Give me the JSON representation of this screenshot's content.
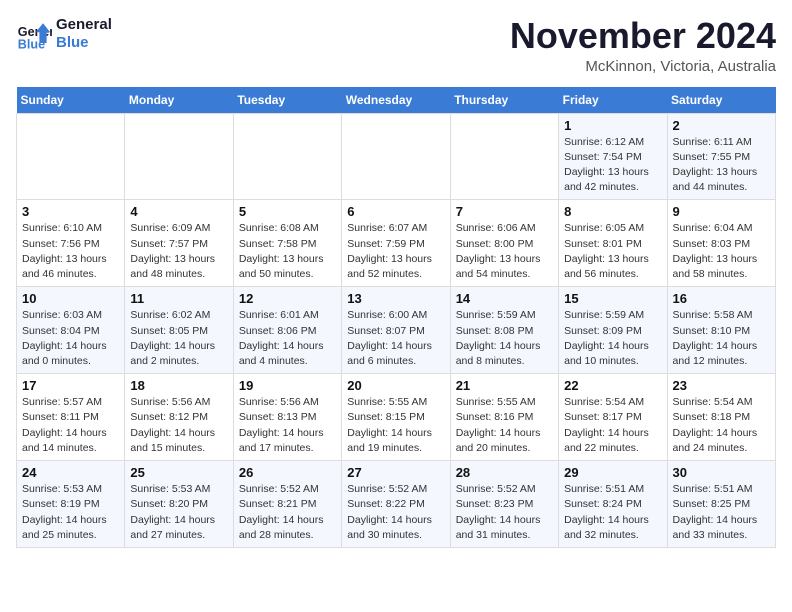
{
  "logo": {
    "line1": "General",
    "line2": "Blue"
  },
  "header": {
    "month": "November 2024",
    "location": "McKinnon, Victoria, Australia"
  },
  "weekdays": [
    "Sunday",
    "Monday",
    "Tuesday",
    "Wednesday",
    "Thursday",
    "Friday",
    "Saturday"
  ],
  "weeks": [
    [
      {
        "day": "",
        "info": ""
      },
      {
        "day": "",
        "info": ""
      },
      {
        "day": "",
        "info": ""
      },
      {
        "day": "",
        "info": ""
      },
      {
        "day": "",
        "info": ""
      },
      {
        "day": "1",
        "info": "Sunrise: 6:12 AM\nSunset: 7:54 PM\nDaylight: 13 hours and 42 minutes."
      },
      {
        "day": "2",
        "info": "Sunrise: 6:11 AM\nSunset: 7:55 PM\nDaylight: 13 hours and 44 minutes."
      }
    ],
    [
      {
        "day": "3",
        "info": "Sunrise: 6:10 AM\nSunset: 7:56 PM\nDaylight: 13 hours and 46 minutes."
      },
      {
        "day": "4",
        "info": "Sunrise: 6:09 AM\nSunset: 7:57 PM\nDaylight: 13 hours and 48 minutes."
      },
      {
        "day": "5",
        "info": "Sunrise: 6:08 AM\nSunset: 7:58 PM\nDaylight: 13 hours and 50 minutes."
      },
      {
        "day": "6",
        "info": "Sunrise: 6:07 AM\nSunset: 7:59 PM\nDaylight: 13 hours and 52 minutes."
      },
      {
        "day": "7",
        "info": "Sunrise: 6:06 AM\nSunset: 8:00 PM\nDaylight: 13 hours and 54 minutes."
      },
      {
        "day": "8",
        "info": "Sunrise: 6:05 AM\nSunset: 8:01 PM\nDaylight: 13 hours and 56 minutes."
      },
      {
        "day": "9",
        "info": "Sunrise: 6:04 AM\nSunset: 8:03 PM\nDaylight: 13 hours and 58 minutes."
      }
    ],
    [
      {
        "day": "10",
        "info": "Sunrise: 6:03 AM\nSunset: 8:04 PM\nDaylight: 14 hours and 0 minutes."
      },
      {
        "day": "11",
        "info": "Sunrise: 6:02 AM\nSunset: 8:05 PM\nDaylight: 14 hours and 2 minutes."
      },
      {
        "day": "12",
        "info": "Sunrise: 6:01 AM\nSunset: 8:06 PM\nDaylight: 14 hours and 4 minutes."
      },
      {
        "day": "13",
        "info": "Sunrise: 6:00 AM\nSunset: 8:07 PM\nDaylight: 14 hours and 6 minutes."
      },
      {
        "day": "14",
        "info": "Sunrise: 5:59 AM\nSunset: 8:08 PM\nDaylight: 14 hours and 8 minutes."
      },
      {
        "day": "15",
        "info": "Sunrise: 5:59 AM\nSunset: 8:09 PM\nDaylight: 14 hours and 10 minutes."
      },
      {
        "day": "16",
        "info": "Sunrise: 5:58 AM\nSunset: 8:10 PM\nDaylight: 14 hours and 12 minutes."
      }
    ],
    [
      {
        "day": "17",
        "info": "Sunrise: 5:57 AM\nSunset: 8:11 PM\nDaylight: 14 hours and 14 minutes."
      },
      {
        "day": "18",
        "info": "Sunrise: 5:56 AM\nSunset: 8:12 PM\nDaylight: 14 hours and 15 minutes."
      },
      {
        "day": "19",
        "info": "Sunrise: 5:56 AM\nSunset: 8:13 PM\nDaylight: 14 hours and 17 minutes."
      },
      {
        "day": "20",
        "info": "Sunrise: 5:55 AM\nSunset: 8:15 PM\nDaylight: 14 hours and 19 minutes."
      },
      {
        "day": "21",
        "info": "Sunrise: 5:55 AM\nSunset: 8:16 PM\nDaylight: 14 hours and 20 minutes."
      },
      {
        "day": "22",
        "info": "Sunrise: 5:54 AM\nSunset: 8:17 PM\nDaylight: 14 hours and 22 minutes."
      },
      {
        "day": "23",
        "info": "Sunrise: 5:54 AM\nSunset: 8:18 PM\nDaylight: 14 hours and 24 minutes."
      }
    ],
    [
      {
        "day": "24",
        "info": "Sunrise: 5:53 AM\nSunset: 8:19 PM\nDaylight: 14 hours and 25 minutes."
      },
      {
        "day": "25",
        "info": "Sunrise: 5:53 AM\nSunset: 8:20 PM\nDaylight: 14 hours and 27 minutes."
      },
      {
        "day": "26",
        "info": "Sunrise: 5:52 AM\nSunset: 8:21 PM\nDaylight: 14 hours and 28 minutes."
      },
      {
        "day": "27",
        "info": "Sunrise: 5:52 AM\nSunset: 8:22 PM\nDaylight: 14 hours and 30 minutes."
      },
      {
        "day": "28",
        "info": "Sunrise: 5:52 AM\nSunset: 8:23 PM\nDaylight: 14 hours and 31 minutes."
      },
      {
        "day": "29",
        "info": "Sunrise: 5:51 AM\nSunset: 8:24 PM\nDaylight: 14 hours and 32 minutes."
      },
      {
        "day": "30",
        "info": "Sunrise: 5:51 AM\nSunset: 8:25 PM\nDaylight: 14 hours and 33 minutes."
      }
    ]
  ]
}
